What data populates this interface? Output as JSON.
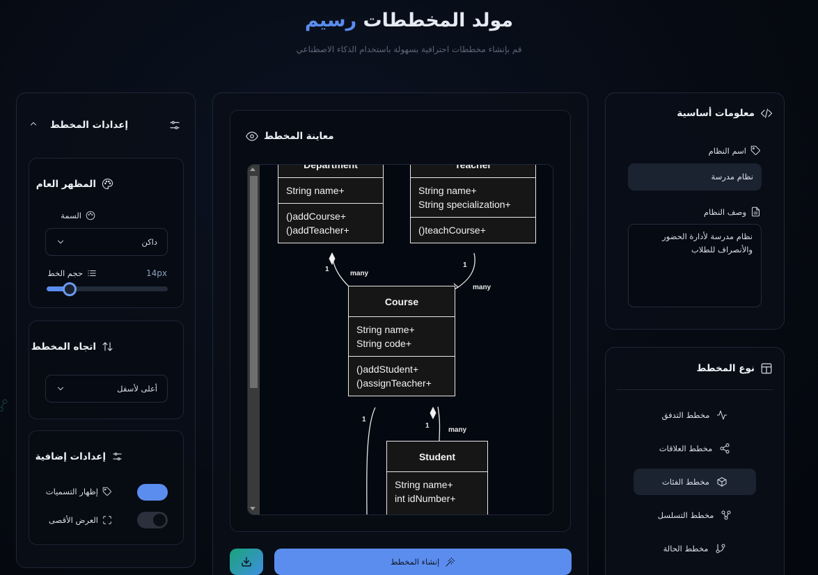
{
  "header": {
    "title_main": "مولد المخططات",
    "title_accent": "رسيم",
    "subtitle": "قم بإنشاء مخططات احترافية بسهولة باستخدام الذكاء الاصطناعي"
  },
  "basic_info": {
    "title": "معلومات أساسية",
    "system_name_label": "اسم النظام",
    "system_name_value": "نظام مدرسة",
    "description_label": "وصف النظام",
    "description_value": "نظام مدرسة لأدارة الحضور والأنصراف للطلاب"
  },
  "diagram_type": {
    "title": "نوع المخطط",
    "items": [
      {
        "label": "مخطط التدفق",
        "icon": "activity-icon",
        "active": false
      },
      {
        "label": "مخطط العلاقات",
        "icon": "share-icon",
        "active": false
      },
      {
        "label": "مخطط الفئات",
        "icon": "cube-icon",
        "active": true
      },
      {
        "label": "مخطط التسلسل",
        "icon": "nodes-icon",
        "active": false
      },
      {
        "label": "مخطط الحالة",
        "icon": "git-branch-icon",
        "active": false
      }
    ]
  },
  "preview": {
    "title": "معاينة المخطط",
    "classes": {
      "department": {
        "name": "Department",
        "attributes": [
          "String name+"
        ],
        "methods": [
          "()addCourse+",
          "()addTeacher+"
        ]
      },
      "teacher": {
        "name": "Teacher",
        "attributes": [
          "String name+",
          "String specialization+"
        ],
        "methods": [
          "()teachCourse+"
        ]
      },
      "course": {
        "name": "Course",
        "attributes": [
          "String name+",
          "String code+"
        ],
        "methods": [
          "()addStudent+",
          "()assignTeacher+"
        ]
      },
      "student": {
        "name": "Student",
        "attributes": [
          "String name+",
          "int idNumber+"
        ],
        "methods": []
      }
    },
    "labels": {
      "one": "1",
      "many": "many"
    }
  },
  "actions": {
    "generate_label": "إنشاء المخطط",
    "download_icon": "download-icon"
  },
  "settings": {
    "title": "إعدادات المخطط",
    "appearance": {
      "title": "المظهر العام",
      "theme_label": "السمة",
      "theme_value": "داكن",
      "font_size_label": "حجم الخط",
      "font_size_value": "14px",
      "font_size_fraction": 0.19
    },
    "direction": {
      "title": "اتجاه المخطط",
      "value": "أعلى لأسفل"
    },
    "extra": {
      "title": "إعدادات إضافية",
      "show_labels_label": "إظهار التسميات",
      "show_labels_on": true,
      "fullscreen_label": "العرض الأقصى",
      "fullscreen_on": false
    }
  },
  "colors": {
    "accent": "#5b8def",
    "bg": "#060a12",
    "panel_border": "#1f2838"
  }
}
